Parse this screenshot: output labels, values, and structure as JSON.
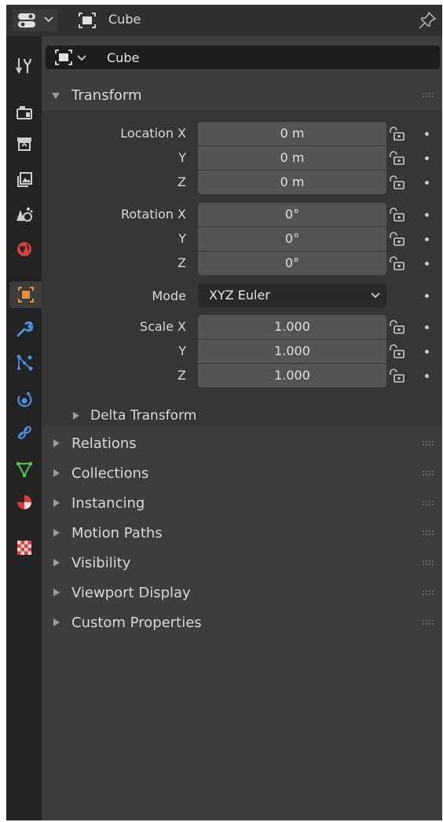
{
  "header": {
    "title": "Cube",
    "editor_type_icon": "properties-editor-icon",
    "pin_icon": "pin-icon"
  },
  "tabs": [
    {
      "name": "tool",
      "icon": "tool-settings-icon"
    },
    {
      "name": "render",
      "icon": "render-icon"
    },
    {
      "name": "output",
      "icon": "output-icon"
    },
    {
      "name": "view-layer",
      "icon": "view-layer-icon"
    },
    {
      "name": "scene",
      "icon": "scene-icon"
    },
    {
      "name": "world",
      "icon": "world-icon"
    },
    {
      "name": "object",
      "icon": "object-icon",
      "active": true
    },
    {
      "name": "modifiers",
      "icon": "wrench-icon"
    },
    {
      "name": "particles",
      "icon": "particles-icon"
    },
    {
      "name": "physics",
      "icon": "physics-icon"
    },
    {
      "name": "constraints",
      "icon": "constraints-icon"
    },
    {
      "name": "data",
      "icon": "mesh-data-icon"
    },
    {
      "name": "material",
      "icon": "material-icon"
    },
    {
      "name": "texture",
      "icon": "texture-icon"
    }
  ],
  "context": {
    "name": "Cube"
  },
  "transform": {
    "label": "Transform",
    "location": {
      "label": "Location X",
      "y_label": "Y",
      "z_label": "Z",
      "x": "0 m",
      "y": "0 m",
      "z": "0 m"
    },
    "rotation": {
      "label": "Rotation X",
      "y_label": "Y",
      "z_label": "Z",
      "x": "0°",
      "y": "0°",
      "z": "0°"
    },
    "mode": {
      "label": "Mode",
      "value": "XYZ Euler"
    },
    "scale": {
      "label": "Scale X",
      "y_label": "Y",
      "z_label": "Z",
      "x": "1.000",
      "y": "1.000",
      "z": "1.000"
    },
    "delta": "Delta Transform"
  },
  "panels": [
    "Relations",
    "Collections",
    "Instancing",
    "Motion Paths",
    "Visibility",
    "Viewport Display",
    "Custom Properties"
  ],
  "colors": {
    "object_orange": "#e8913a",
    "modifier_blue": "#4d8fe0",
    "green": "#4fc24f",
    "red": "#d64040"
  }
}
